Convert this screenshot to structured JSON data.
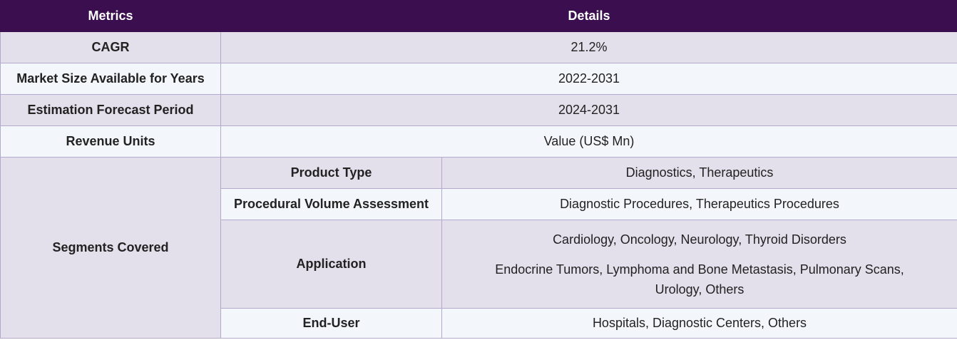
{
  "header": {
    "col1": "Metrics",
    "col2": "Details"
  },
  "rows": [
    {
      "label": "CAGR",
      "value": "21.2%"
    },
    {
      "label": "Market Size Available for Years",
      "value": "2022-2031"
    },
    {
      "label": "Estimation Forecast Period",
      "value": "2024-2031"
    },
    {
      "label": "Revenue Units",
      "value": "Value (US$ Mn)"
    }
  ],
  "segments": {
    "label": "Segments Covered",
    "items": [
      {
        "name": "Product Type",
        "value": "Diagnostics, Therapeutics"
      },
      {
        "name": "Procedural Volume Assessment",
        "value": "Diagnostic Procedures, Therapeutics Procedures"
      },
      {
        "name": "Application",
        "value_line1": "Cardiology, Oncology, Neurology, Thyroid Disorders",
        "value_line2": "Endocrine Tumors, Lymphoma and Bone Metastasis, Pulmonary Scans, Urology, Others"
      },
      {
        "name": "End-User",
        "value": "Hospitals, Diagnostic Centers, Others"
      }
    ]
  }
}
